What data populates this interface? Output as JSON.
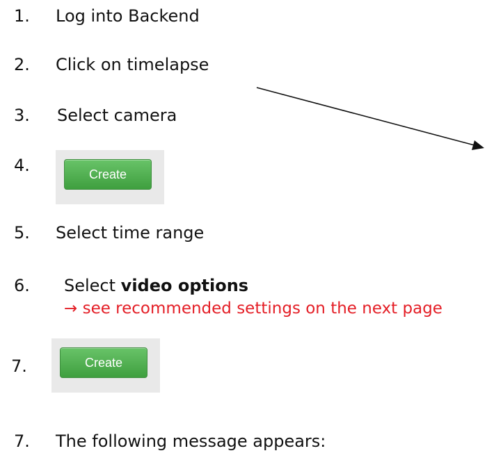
{
  "steps": [
    {
      "num": "1.",
      "text": "Log into Backend"
    },
    {
      "num": "2.",
      "text": "Click on timelapse"
    },
    {
      "num": "3.",
      "text": "Select camera"
    },
    {
      "num": "4.",
      "button": "Create"
    },
    {
      "num": "5.",
      "text": "Select time range"
    },
    {
      "num": "6.",
      "text_prefix": "Select ",
      "text_bold": "video options",
      "hint_arrow": "→",
      "hint": " see recommended settings on the next page"
    },
    {
      "num": "7.",
      "button": "Create"
    },
    {
      "num": "7.",
      "text": "The following message appears:"
    }
  ],
  "colors": {
    "hint": "#e41e26",
    "button": "#4cae4c",
    "text": "#111111"
  }
}
